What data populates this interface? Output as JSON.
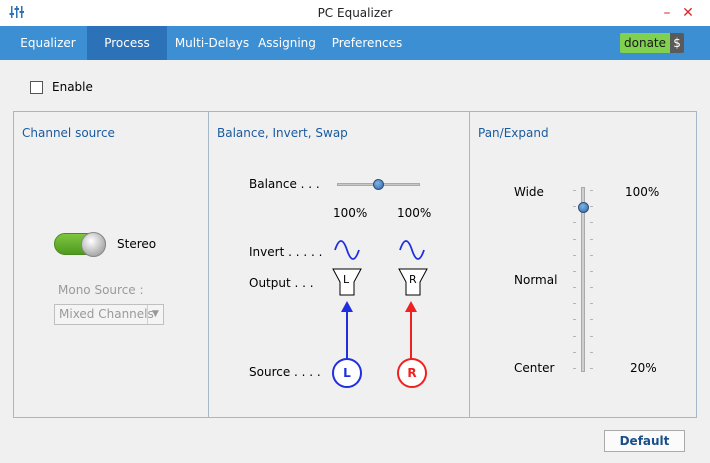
{
  "window": {
    "title": "PC Equalizer",
    "minimize_glyph": "–",
    "close_glyph": "✕"
  },
  "tabs": [
    {
      "label": "Equalizer"
    },
    {
      "label": "Process"
    },
    {
      "label": "Multi-Delays"
    },
    {
      "label": "Assigning"
    },
    {
      "label": "Preferences"
    }
  ],
  "active_tab": "Process",
  "donate": {
    "label": "donate",
    "symbol": "$"
  },
  "enable": {
    "label": "Enable",
    "checked": false
  },
  "channel_source": {
    "title": "Channel source",
    "toggle_label": "Stereo",
    "toggle_on": true,
    "mono_source_label": "Mono Source :",
    "mono_source_value": "Mixed Channels"
  },
  "balance": {
    "title": "Balance, Invert, Swap",
    "balance_label": "Balance . . .",
    "left_percent": "100%",
    "right_percent": "100%",
    "balance_position": 0.5,
    "invert_label": "Invert . . . . .",
    "output_label": "Output  . . .",
    "source_label": "Source . . . .",
    "left_channel": "L",
    "right_channel": "R"
  },
  "pan_expand": {
    "title": "Pan/Expand",
    "wide_label": "Wide",
    "normal_label": "Normal",
    "center_label": "Center",
    "top_value": "100%",
    "bottom_value": "20%",
    "slider_level": 0.9
  },
  "default_button": "Default",
  "colors": {
    "accent": "#3d8fd4",
    "left": "#1f2fe0",
    "right": "#f02020",
    "title_blue": "#1a5a9e"
  }
}
